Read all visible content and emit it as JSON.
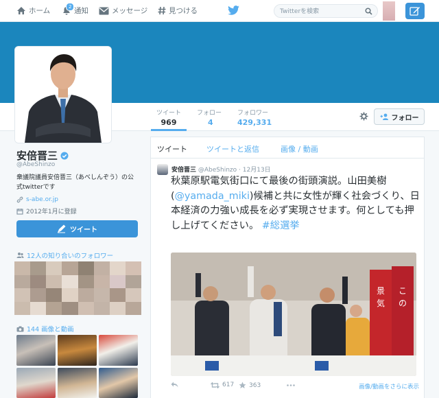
{
  "nav": {
    "home": "ホーム",
    "notifications": "通知",
    "notifications_count": "2",
    "messages": "メッセージ",
    "discover": "見つける",
    "search_placeholder": "Twitterを検索"
  },
  "profile_nav": {
    "tweets_label": "ツイート",
    "tweets_value": "969",
    "following_label": "フォロー",
    "following_value": "4",
    "followers_label": "フォロワー",
    "followers_value": "429,331",
    "follow_button": "フォロー"
  },
  "profile": {
    "name": "安倍晋三",
    "screen_name": "@AbeShinzo",
    "bio": "衆議院議員安倍晋三（あべしんぞう）の公式twitterです",
    "url": "s-abe.or.jp",
    "joined": "2012年1月に登録",
    "tweet_button": "ツイート"
  },
  "sidebar": {
    "friends_header": "12人の知り合いのフォロワー",
    "media_header": "144 画像と動画"
  },
  "timeline": {
    "tabs": [
      "ツイート",
      "ツイートと返信",
      "画像 / 動画"
    ]
  },
  "tweet": {
    "name": "安倍晋三",
    "handle": "@AbeShinzo",
    "sep": "·",
    "date": "12月13日",
    "text_1": "秋葉原駅電気街口にて最後の街頭演説。山田美樹(",
    "mention": "@yamada_miki",
    "text_2": ")候補と共に女性が輝く社会づくり、日本経済の力強い成長を必ず実現させます。何としても押し上げてください。 ",
    "hashtag": "#総選挙",
    "retweets": "617",
    "favorites": "363",
    "more_media": "画像/動画をさらに表示"
  },
  "colors": {
    "accent": "#55acee",
    "banner": "#1b86bd",
    "button": "#3b94d9"
  },
  "icons": [
    "home-icon",
    "bell-icon",
    "mail-icon",
    "hash-icon",
    "bird-icon",
    "search-icon",
    "compose-icon",
    "gear-icon",
    "add-user-icon",
    "verified-icon",
    "link-icon",
    "calendar-icon",
    "quill-icon",
    "people-icon",
    "camera-icon",
    "reply-icon",
    "retweet-icon",
    "star-icon",
    "more-icon"
  ]
}
